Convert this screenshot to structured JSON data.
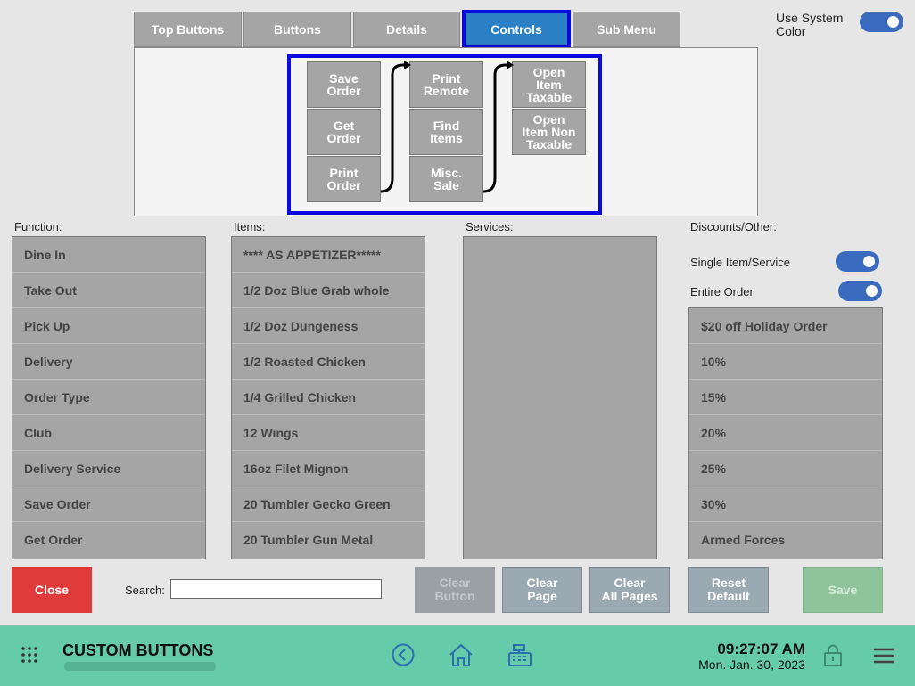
{
  "tabs": [
    {
      "label": "Top Buttons"
    },
    {
      "label": "Buttons"
    },
    {
      "label": "Details"
    },
    {
      "label": "Controls"
    },
    {
      "label": "Sub Menu"
    }
  ],
  "system_color": {
    "label": "Use System\nColor",
    "enabled": true
  },
  "controls": {
    "col1": [
      "Save\nOrder",
      "Get\nOrder",
      "Print\nOrder"
    ],
    "col2": [
      "Print\nRemote",
      "Find\nItems",
      "Misc.\nSale"
    ],
    "col3": [
      "Open\nItem\nTaxable",
      "Open\nItem Non\nTaxable"
    ]
  },
  "function": {
    "label": "Function:",
    "items": [
      "Dine In",
      "Take Out",
      "Pick Up",
      "Delivery",
      "Order Type",
      "Club",
      "Delivery Service",
      "Save Order",
      "Get Order"
    ]
  },
  "items": {
    "label": "Items:",
    "items": [
      "**** AS APPETIZER*****",
      "1/2 Doz Blue Grab whole",
      "1/2 Doz Dungeness",
      "1/2 Roasted Chicken",
      "1/4 Grilled Chicken",
      "12 Wings",
      "16oz Filet Mignon",
      "20 Tumbler Gecko Green",
      "20 Tumbler Gun Metal"
    ]
  },
  "services": {
    "label": "Services:"
  },
  "discounts": {
    "label": "Discounts/Other:",
    "single_label": "Single Item/Service",
    "entire_label": "Entire Order",
    "items": [
      "$20 off Holiday Order",
      "10%",
      "15%",
      "20%",
      "25%",
      "30%",
      "Armed Forces"
    ]
  },
  "actions": {
    "close": "Close",
    "search_label": "Search:",
    "search_value": "",
    "clear_button": "Clear\nButton",
    "clear_page": "Clear\nPage",
    "clear_all_pages": "Clear\nAll Pages",
    "reset_default": "Reset\nDefault",
    "save": "Save"
  },
  "footer": {
    "title": "CUSTOM BUTTONS",
    "time": "09:27:07 AM",
    "date": "Mon. Jan. 30, 2023"
  },
  "colors": {
    "accent": "#2b7fc4",
    "highlight": "#0a0adf",
    "close": "#e03a3a",
    "save": "#8fc39a",
    "footer": "#66cba9"
  }
}
